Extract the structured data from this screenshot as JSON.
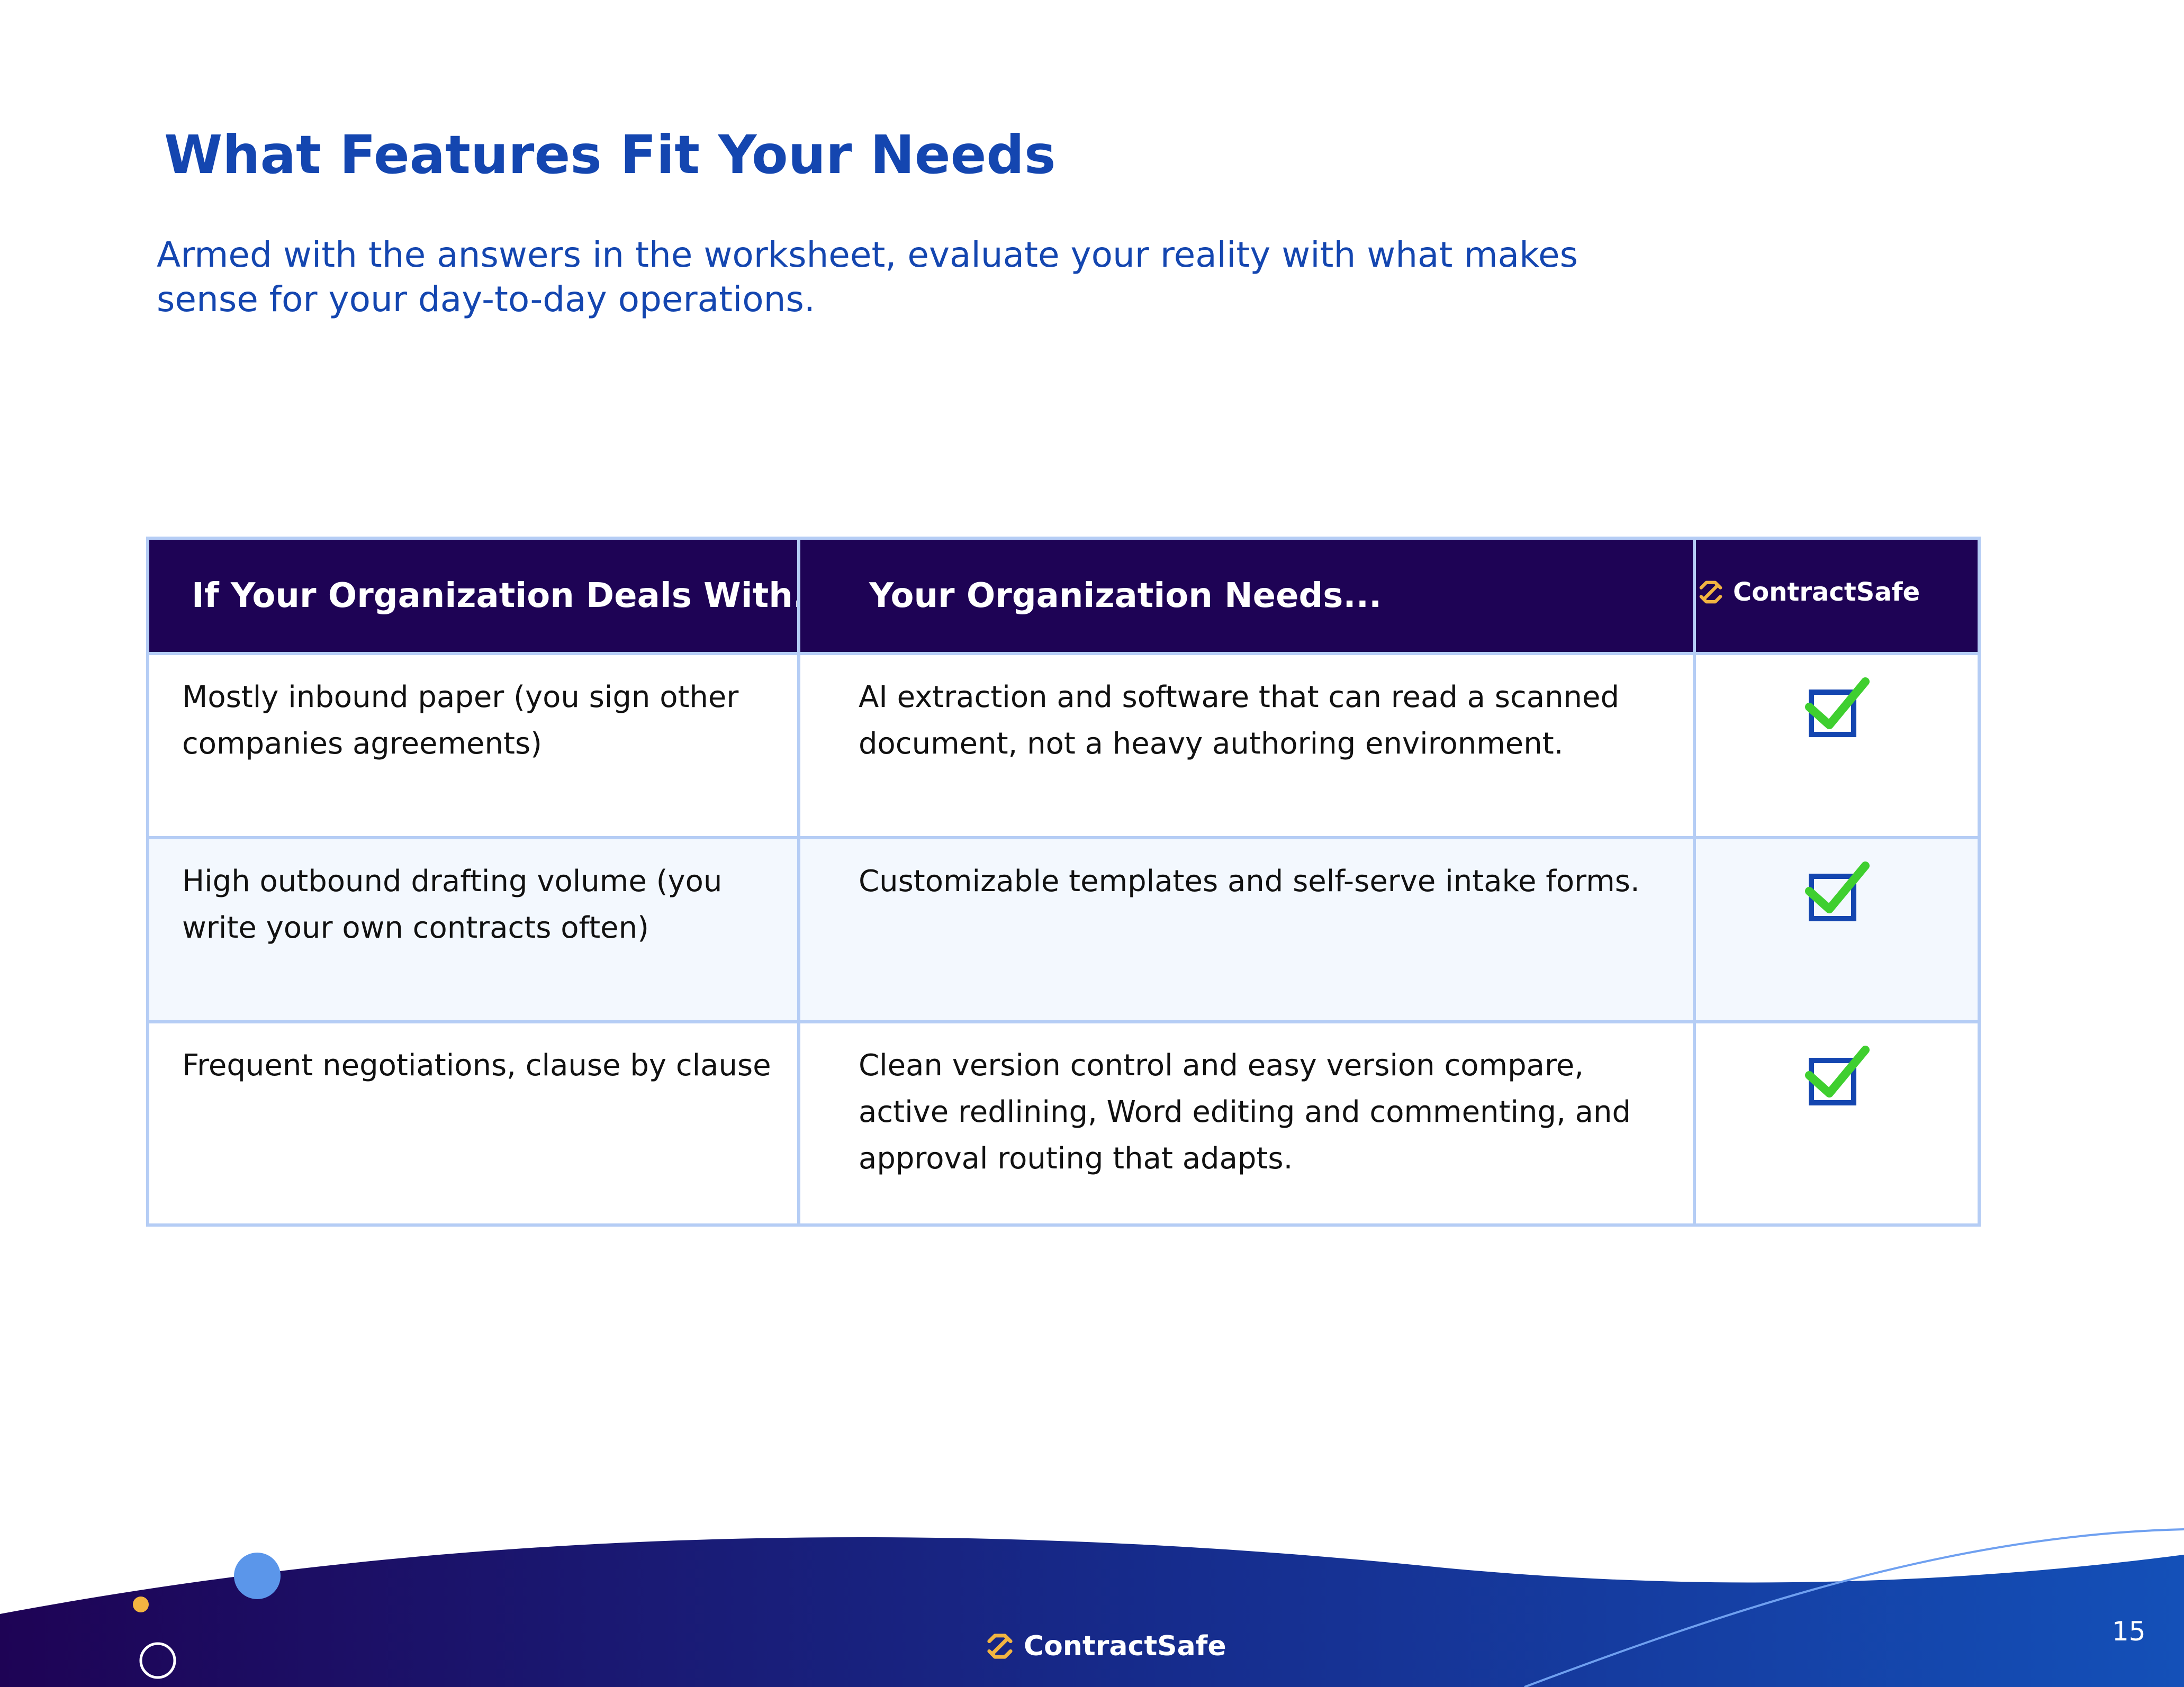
{
  "page": {
    "title": "What Features Fit Your Needs",
    "subtitle": "Armed with the answers in the worksheet, evaluate your reality with what makes sense for your day-to-day operations.",
    "page_number": "15"
  },
  "table": {
    "headers": {
      "col_a": "If Your Organization Deals With...",
      "col_b": "Your Organization Needs...",
      "col_c_logo": "ContractSafe"
    },
    "rows": [
      {
        "deals_with": "Mostly inbound paper (you sign other companies agreements)",
        "needs": "AI extraction and software that can read a scanned document, not a heavy authoring environment.",
        "check_icon": "checked-box-icon"
      },
      {
        "deals_with": "High outbound drafting volume (you write your own contracts often)",
        "needs": "Customizable templates and self-serve intake forms.",
        "check_icon": "checked-box-icon"
      },
      {
        "deals_with": "Frequent negotiations, clause by clause",
        "needs": "Clean version control and easy version compare, active redlining, Word editing and commenting, and approval routing that adapts.",
        "check_icon": "checked-box-icon"
      }
    ]
  },
  "footer": {
    "logo_text": "ContractSafe"
  },
  "colors": {
    "title_blue": "#1446b0",
    "header_bg": "#1e0355",
    "table_border": "#b5cdf5",
    "alt_row_bg": "#f3f8fe",
    "check_green": "#3fcf2f",
    "box_blue": "#1446b0",
    "logo_gold": "#f2b441",
    "footer_dark": "#1e0355",
    "footer_blue": "#1450b8"
  }
}
